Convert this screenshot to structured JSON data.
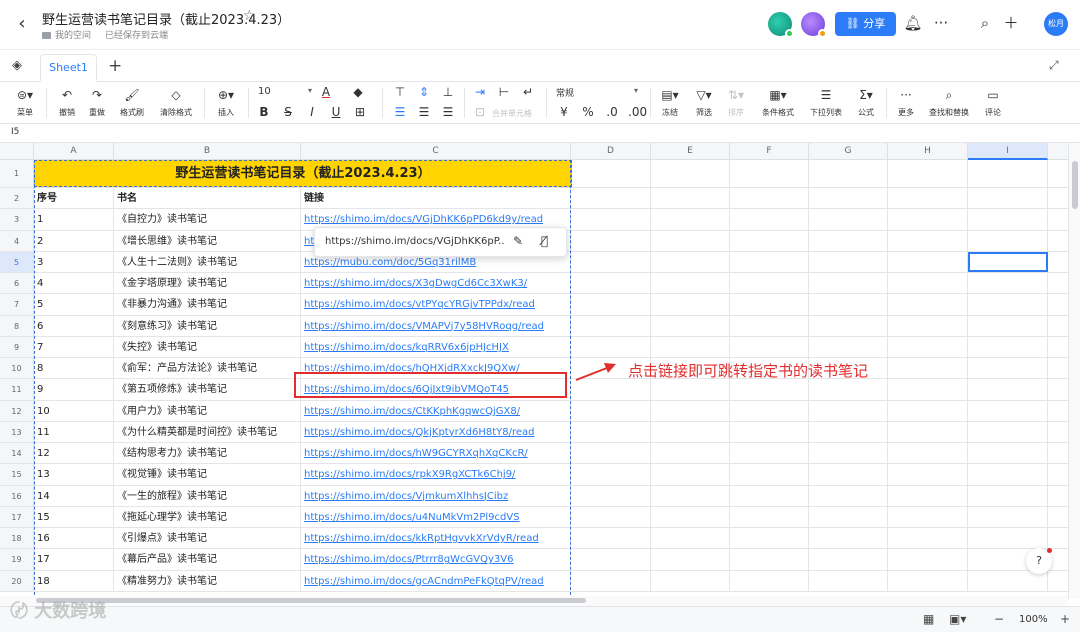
{
  "header": {
    "back": "‹",
    "title": "野生运营读书笔记目录（截止2023.4.23）",
    "breadcrumb": "我的空间",
    "save_status": "已经保存到云端",
    "share_label": "分享",
    "user_name": "松月"
  },
  "tabs": {
    "sheets": [
      "Sheet1"
    ]
  },
  "toolbar": {
    "menu": "菜单",
    "undo": "撤销",
    "redo": "重做",
    "format_painter": "格式刷",
    "clear_format": "清除格式",
    "insert": "插入",
    "font_size": "10",
    "merge_cells": "合并单元格",
    "number_format": "常规",
    "freeze": "冻结",
    "filter": "筛选",
    "sort": "排序",
    "conditional_format": "条件格式",
    "dropdown_list": "下拉列表",
    "formula": "公式",
    "more": "更多",
    "find_replace": "查找和替换",
    "comment": "评论"
  },
  "formula_bar": {
    "cell_ref": "I5"
  },
  "grid": {
    "columns": [
      "A",
      "B",
      "C",
      "D",
      "E",
      "F",
      "G",
      "H",
      "I"
    ],
    "selected_column": "I",
    "selected_row": "5",
    "title": "野生运营读书笔记目录（截止2023.4.23）",
    "headers": [
      "序号",
      "书名",
      "链接"
    ],
    "rows": [
      {
        "n": "3",
        "no": "1",
        "book": "《自控力》读书笔记",
        "link": "https://shimo.im/docs/VGjDhKK6pPD6kd9y/read"
      },
      {
        "n": "4",
        "no": "2",
        "book": "《增长思维》读书笔记",
        "link": "ht"
      },
      {
        "n": "5",
        "no": "3",
        "book": "《人生十二法则》读书笔记",
        "link": "https://mubu.com/doc/5Gq31rilMB"
      },
      {
        "n": "6",
        "no": "4",
        "book": "《金字塔原理》读书笔记",
        "link": "https://shimo.im/docs/X3gDwgCd6Cc3XwK3/"
      },
      {
        "n": "7",
        "no": "5",
        "book": "《非暴力沟通》读书笔记",
        "link": "https://shimo.im/docs/vtPYqcYRGjvTPPdx/read"
      },
      {
        "n": "8",
        "no": "6",
        "book": "《刻意练习》读书笔记",
        "link": "https://shimo.im/docs/VMAPVj7y58HVRoqg/read"
      },
      {
        "n": "9",
        "no": "7",
        "book": "《失控》读书笔记",
        "link": "https://shimo.im/docs/kqRRV6x6jpHJcHJX"
      },
      {
        "n": "10",
        "no": "8",
        "book": "《俞军：产品方法论》读书笔记",
        "link": "https://shimo.im/docs/hQHXjdRXxckJ9QXw/"
      },
      {
        "n": "11",
        "no": "9",
        "book": "《第五项修炼》读书笔记",
        "link": "https://shimo.im/docs/6QjJxt9ibVMQoT45"
      },
      {
        "n": "12",
        "no": "10",
        "book": "《用户力》读书笔记",
        "link": "https://shimo.im/docs/CtKKphKgqwcQjGX8/"
      },
      {
        "n": "13",
        "no": "11",
        "book": "《为什么精英都是时间控》读书笔记",
        "link": "https://shimo.im/docs/QkjKptyrXd6H8tY8/read"
      },
      {
        "n": "14",
        "no": "12",
        "book": "《结构思考力》读书笔记",
        "link": "https://shimo.im/docs/hW9GCYRXqhXqCKcR/"
      },
      {
        "n": "15",
        "no": "13",
        "book": "《视觉锤》读书笔记",
        "link": "https://shimo.im/docs/rpkX9RgXCTk6Chj9/"
      },
      {
        "n": "16",
        "no": "14",
        "book": "《一生的旅程》读书笔记",
        "link": "https://shimo.im/docs/VjmkumXlhhsJCibz"
      },
      {
        "n": "17",
        "no": "15",
        "book": "《拖延心理学》读书笔记",
        "link": "https://shimo.im/docs/u4NuMkVm2Pl9cdVS"
      },
      {
        "n": "18",
        "no": "16",
        "book": "《引爆点》读书笔记",
        "link": "https://shimo.im/docs/kkRptHgvvkXrVdyR/read"
      },
      {
        "n": "19",
        "no": "17",
        "book": "《幕后产品》读书笔记",
        "link": "https://shimo.im/docs/Ptrrr8gWcGVQy3V6"
      },
      {
        "n": "20",
        "no": "18",
        "book": "《精准努力》读书笔记",
        "link": "https://shimo.im/docs/gcACndmPeFkQtqPV/read"
      }
    ]
  },
  "link_popup": {
    "url": "https://shimo.im/docs/VGjDhKK6pP..."
  },
  "annotation": {
    "text": "点击链接即可跳转指定书的读书笔记",
    "color": "#e02d2d"
  },
  "status": {
    "zoom": "100%"
  },
  "watermark": "大数跨境",
  "colors": {
    "accent": "#2b7cf6",
    "title_fill": "#ffd400",
    "annotation": "#e02d2d"
  }
}
